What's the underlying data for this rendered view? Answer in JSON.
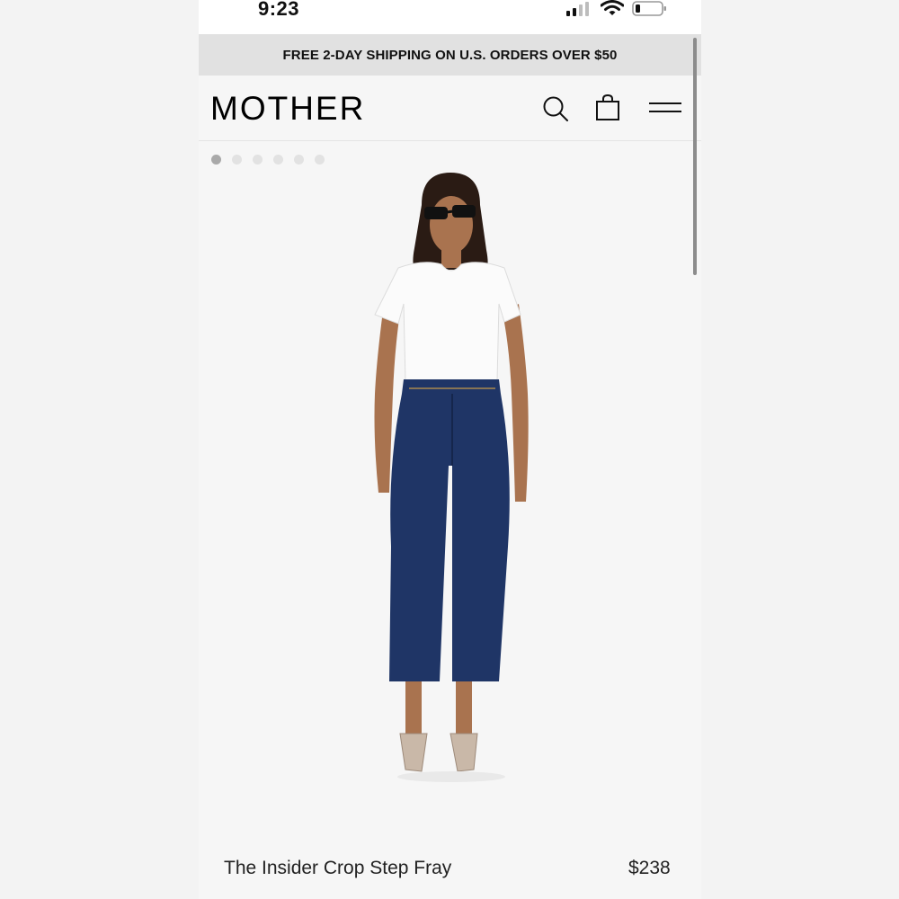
{
  "status_bar": {
    "time": "9:23"
  },
  "promo_banner": {
    "text": "FREE 2-DAY SHIPPING ON U.S. ORDERS OVER $50"
  },
  "header": {
    "logo": "MOTHER",
    "icons": [
      "search-icon",
      "shopping-bag-icon",
      "hamburger-menu-icon"
    ]
  },
  "carousel": {
    "slide_count": 6,
    "active_index": 0
  },
  "product": {
    "name": "The Insider Crop Step Fray",
    "price": "$238"
  },
  "colors": {
    "promo_bg": "#e1e1e1",
    "page_bg": "#f6f6f6",
    "denim": "#1f3566",
    "text": "#111111"
  }
}
